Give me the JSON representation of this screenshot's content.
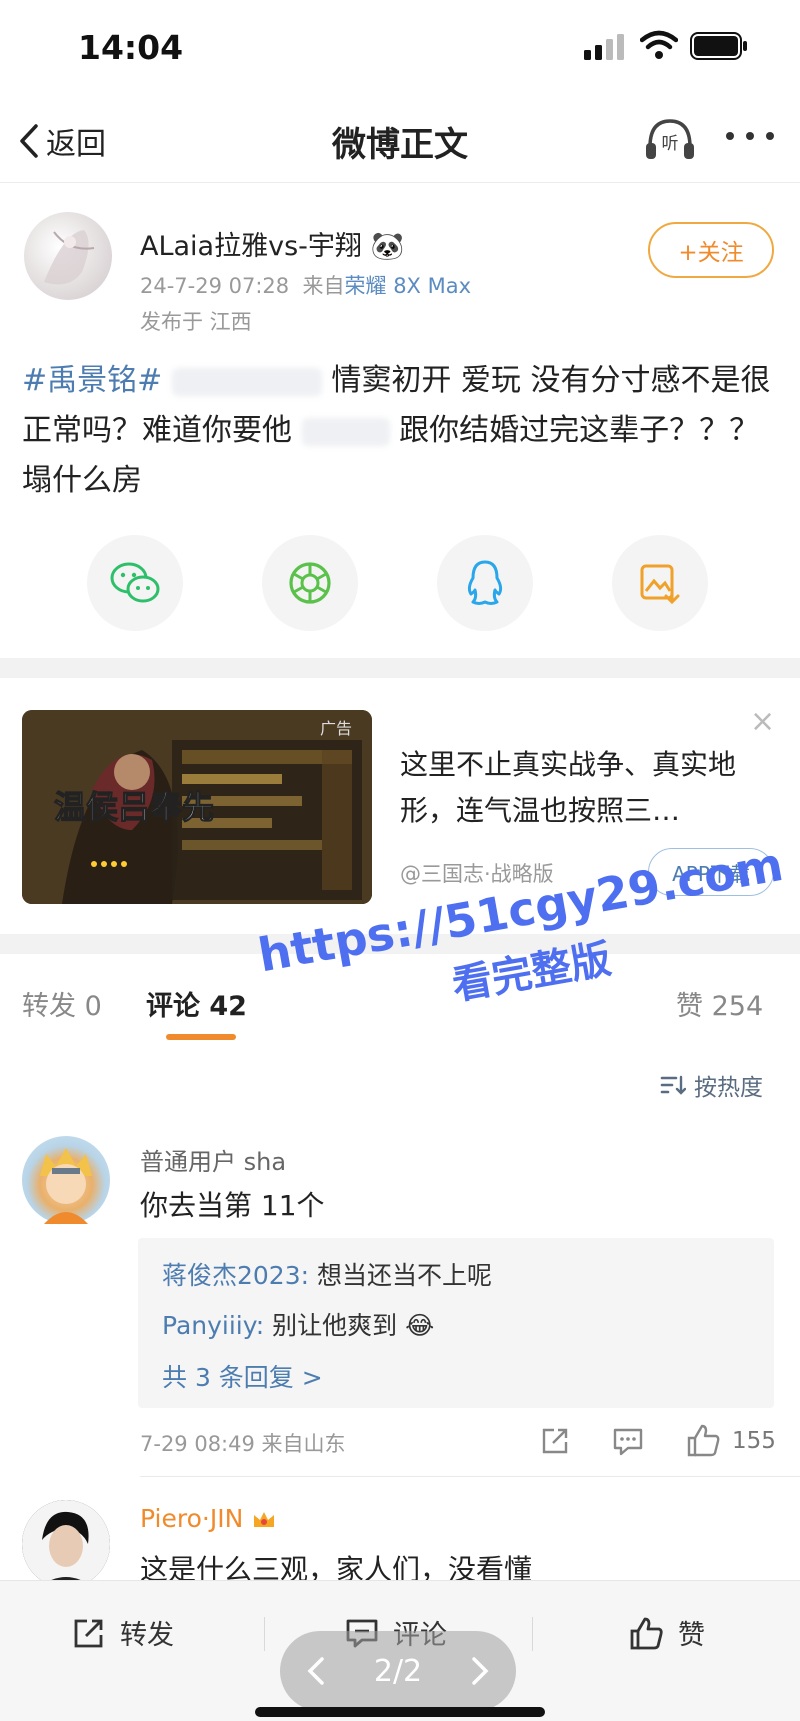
{
  "status_bar": {
    "time": "14:04"
  },
  "nav": {
    "back_label": "返回",
    "title": "微博正文",
    "listen_label": "听"
  },
  "post": {
    "username": "ALaia拉雅vs-宇翔",
    "timestamp": "24-7-29 07:28",
    "source_prefix": "来自",
    "device": "荣耀 8X Max",
    "location": "发布于 江西",
    "follow_label": "+关注",
    "text_tag": "#禹景铭#",
    "text_part1": "情窦初开 爱玩 没有分寸感不是很正常吗？难道你要他",
    "text_part2": "跟你结婚过完这辈子？？？ 塌什么房"
  },
  "share": [
    "wechat-icon",
    "moments-icon",
    "qq-icon",
    "save-image-icon"
  ],
  "ad": {
    "image_title": "温侯吕奉先",
    "badge": "广告",
    "text": "这里不止真实战争、真实地形，连气温也按照三…",
    "source": "@三国志·战略版",
    "download_label": "APP下载",
    "close_glyph": "×"
  },
  "tabs": {
    "repost": "转发 0",
    "comments": "评论 42",
    "likes": "赞 254"
  },
  "sort_label": "按热度",
  "comments": [
    {
      "name": "普通用户 sha",
      "text": "你去当第 11个",
      "replies": [
        {
          "who": "蒋俊杰2023:",
          "text": "想当还当不上呢"
        },
        {
          "who": "Panyiiiy:",
          "text": "别让他爽到"
        }
      ],
      "more_replies": "共 3 条回复 >",
      "meta": "7-29 08:49 来自山东",
      "likes": "155"
    },
    {
      "name": "Piero·JIN",
      "text": "这是什么三观，家人们，没看懂"
    }
  ],
  "bottom_bar": {
    "repost": "转发",
    "comment": "评论",
    "like": "赞",
    "pager": "2/2"
  },
  "watermark": {
    "line1": "https://51cgy29.com",
    "line2": "看完整版"
  },
  "colors": {
    "accent_orange": "#f08b2d",
    "link_blue": "#4d7db0",
    "watermark_blue": "#4d6ff0"
  }
}
